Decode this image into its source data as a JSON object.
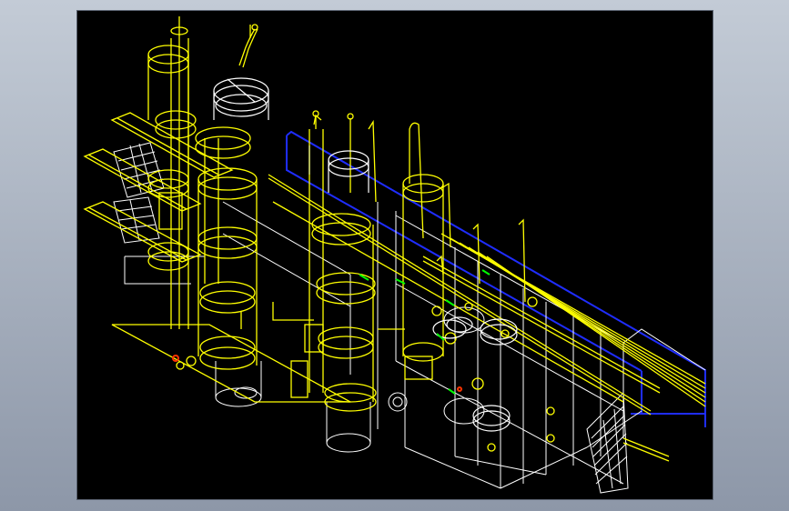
{
  "window": {
    "background_top": "#c3cbd6",
    "background_bottom": "#8d97a8"
  },
  "viewport": {
    "background": "#000000",
    "border": "#5a6270"
  },
  "palette": {
    "structure": "#ffff00",
    "frame": "#ffffff",
    "beam": "#1f2dff",
    "pipe": "#ffff00",
    "valve": "#00ff00",
    "accent": "#ff3300"
  },
  "model": {
    "icon": "cad-wireframe-model",
    "description_visible": false
  }
}
